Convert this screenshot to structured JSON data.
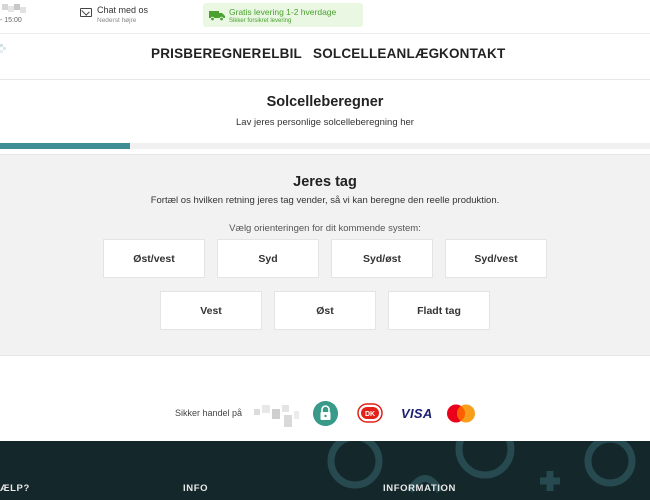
{
  "topbar": {
    "hours": "- 15:00",
    "chat_title": "Chat med os",
    "chat_sub": "Nederst højre",
    "shipping_title": "Gratis levering 1-2 hverdage",
    "shipping_sub": "Sikker forsikret levering",
    "icons": [
      "chat-icon",
      "truck-icon"
    ]
  },
  "nav": {
    "items": [
      "PRISBEREGNER",
      "ELBIL",
      "SOLCELLEANLÆG",
      "KONTAKT"
    ]
  },
  "calculator": {
    "title": "Solcelleberegner",
    "subtitle": "Lav jeres personlige solcelleberegning her",
    "progress_percent": 20,
    "accent_color": "#3f8e96"
  },
  "step": {
    "title": "Jeres tag",
    "description": "Fortæl os hvilken retning jeres tag vender, så vi kan beregne den reelle produktion.",
    "prompt": "Vælg orienteringen for dit kommende system:",
    "options": [
      "Øst/vest",
      "Syd",
      "Syd/øst",
      "Syd/vest",
      "Vest",
      "Øst",
      "Fladt tag"
    ]
  },
  "payment": {
    "secure_label": "Sikker handel på",
    "visa_label": "VISA",
    "icons": [
      "lock-icon",
      "dankort-icon",
      "visa-icon",
      "mastercard-icon"
    ]
  },
  "footer": {
    "headings": [
      "ÆLP?",
      "INFO",
      "INFORMATION"
    ],
    "background_color": "#14282c"
  }
}
